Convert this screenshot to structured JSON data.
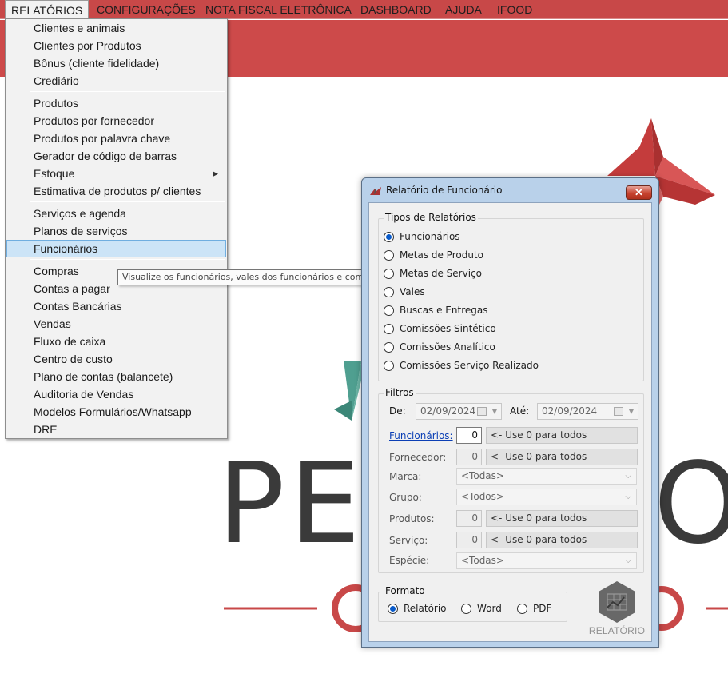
{
  "menubar": {
    "items": [
      "RELATÓRIOS",
      "CONFIGURAÇÕES",
      "NOTA FISCAL ELETRÔNICA",
      "DASHBOARD",
      "AJUDA",
      "IFOOD"
    ],
    "active": "RELATÓRIOS"
  },
  "dropdown": {
    "items": [
      "Clientes e animais",
      "Clientes por Produtos",
      "Bônus (cliente fidelidade)",
      "Crediário",
      "Produtos",
      "Produtos por fornecedor",
      "Produtos por palavra chave",
      "Gerador de código de barras",
      "Estoque",
      "Estimativa de produtos p/ clientes",
      "Serviços e agenda",
      "Planos de serviços",
      "Funcionários",
      "Compras",
      "Contas a pagar",
      "Contas Bancárias",
      "Vendas",
      "Fluxo de caixa",
      "Centro de custo",
      "Plano de contas (balancete)",
      "Auditoria de Vendas",
      "Modelos Formulários/Whatsapp",
      "DRE"
    ],
    "highlighted": "Funcionários",
    "submenu_item": "Estoque"
  },
  "tooltip": "Visualize os funcionários, vales dos funcionários e comissões.",
  "logo": {
    "text": "PE",
    "text_right": "O"
  },
  "dialog": {
    "title": "Relatório de Funcionário",
    "close_glyph": "✕",
    "tipos": {
      "title": "Tipos de Relatórios",
      "options": [
        "Funcionários",
        "Metas de Produto",
        "Metas de Serviço",
        "Vales",
        "Buscas e Entregas",
        "Comissões Sintético",
        "Comissões Analítico",
        "Comissões Serviço Realizado"
      ],
      "selected": "Funcionários"
    },
    "filtros": {
      "title": "Filtros",
      "de_label": "De:",
      "de_value": "02/09/2024",
      "ate_label": "Até:",
      "ate_value": "02/09/2024",
      "funcionarios_label": "Funcionários:",
      "funcionarios_value": "0",
      "funcionarios_hint": "<- Use 0 para todos",
      "fornecedor_label": "Fornecedor:",
      "fornecedor_value": "0",
      "fornecedor_hint": "<- Use 0 para todos",
      "marca_label": "Marca:",
      "marca_value": "<Todas>",
      "grupo_label": "Grupo:",
      "grupo_value": "<Todos>",
      "produtos_label": "Produtos:",
      "produtos_value": "0",
      "produtos_hint": "<- Use 0 para todos",
      "servico_label": "Serviço:",
      "servico_value": "0",
      "servico_hint": "<- Use 0 para todos",
      "especie_label": "Espécie:",
      "especie_value": "<Todas>"
    },
    "formato": {
      "title": "Formato",
      "options": [
        "Relatório",
        "Word",
        "PDF"
      ],
      "selected": "Relatório"
    },
    "report_button": "RELATÓRIO"
  },
  "colors": {
    "brand_red": "#c84848",
    "logo_red": "#cc3a3a",
    "logo_teal": "#4a9c8c",
    "logo_gray": "#3a3a3a",
    "accent_blue": "#0a5bc9"
  }
}
